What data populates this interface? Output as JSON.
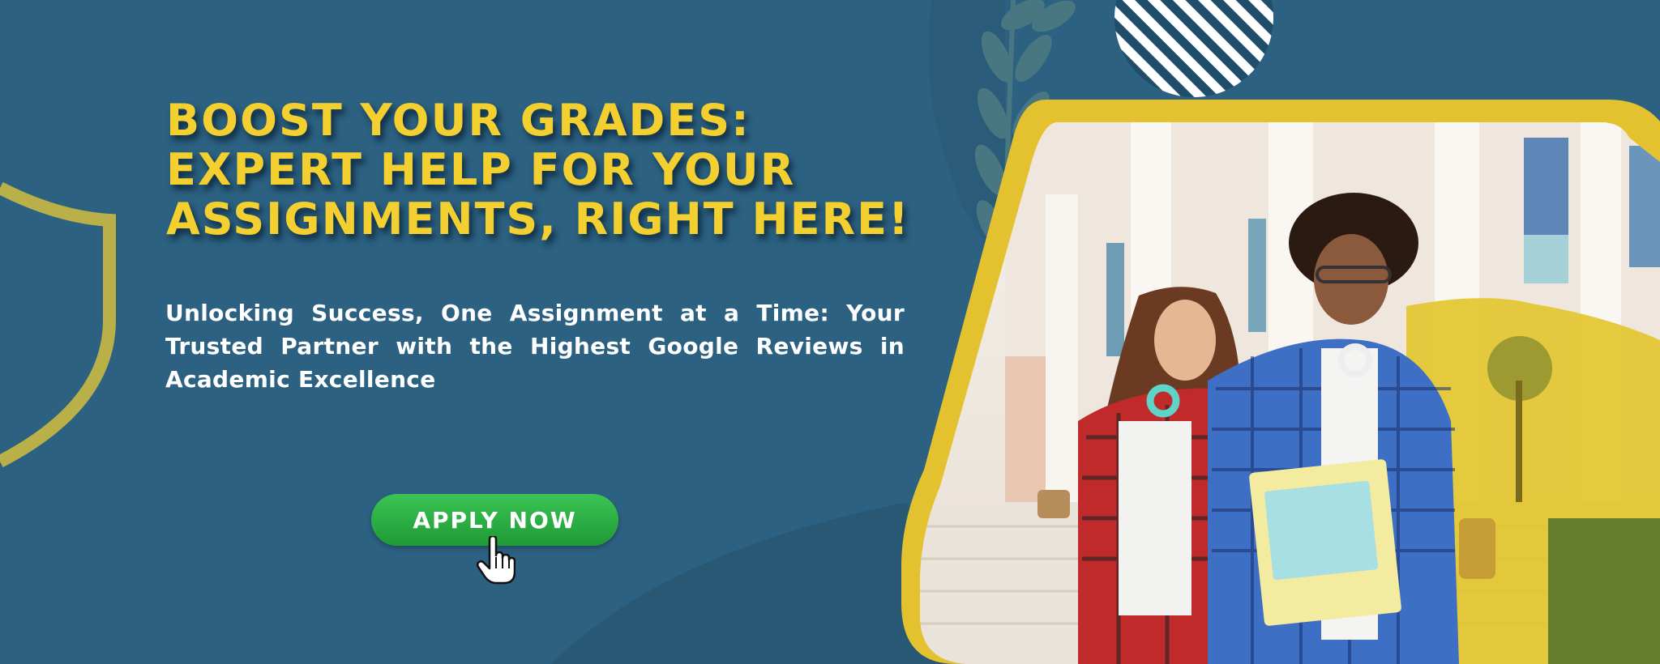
{
  "hero": {
    "headline_lines": [
      "BOOST YOUR GRADES:",
      "EXPERT HELP FOR YOUR",
      "ASSIGNMENTS, RIGHT HERE!"
    ],
    "subtitle": "Unlocking Success, One Assignment at a Time: Your Trusted Partner with the Highest Google Reviews in Academic Excellence",
    "cta_label": "APPLY NOW"
  },
  "icons": {
    "cursor": "hand-pointer-icon",
    "shield": "shield-outline",
    "laurel": "laurel-leaf",
    "striped_circle": "striped-circle"
  },
  "colors": {
    "background": "#2c6181",
    "accent_yellow": "#f3cf2f",
    "cta_green": "#2db346",
    "text_white": "#ffffff"
  }
}
